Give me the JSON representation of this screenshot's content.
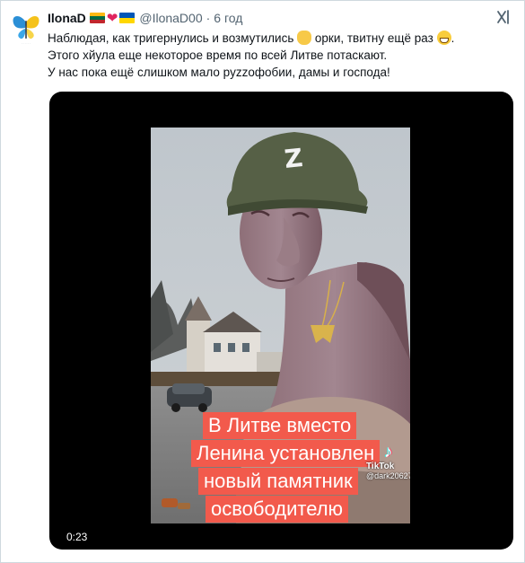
{
  "author": {
    "display_name": "IlonaD",
    "handle": "@IlonaD00",
    "separator": "·",
    "time": "6 год"
  },
  "icons": {
    "avatar": "butterfly-logo",
    "flag_1": "lithuania-flag",
    "heart": "red-heart",
    "flag_2": "ukraine-flag",
    "more": "grok-icon",
    "emoji_1": "ok-hand-emoji",
    "emoji_2": "grinning-face-emoji",
    "tiktok": "tiktok-note-icon"
  },
  "tweet": {
    "line1_a": "Наблюдая, как тригернулись и возмутились",
    "line1_b": "орки, твитну ещё раз",
    "line2": "Этого хйула еще некоторое время по всей Литве потаскают.",
    "line3": "У нас пока ещё слишком мало pyzzофобии, дамы и господа!"
  },
  "video": {
    "caption": [
      "В Литве вместо",
      "Ленина установлен",
      "новый памятник",
      "освободителю"
    ],
    "tiktok_brand": "TikTok",
    "tiktok_user": "@dark20627",
    "timecode": "0:23"
  },
  "colors": {
    "caption_bg": "#f25a4c",
    "text_primary": "#0f1419",
    "text_secondary": "#536471",
    "media_bg": "#000000"
  }
}
